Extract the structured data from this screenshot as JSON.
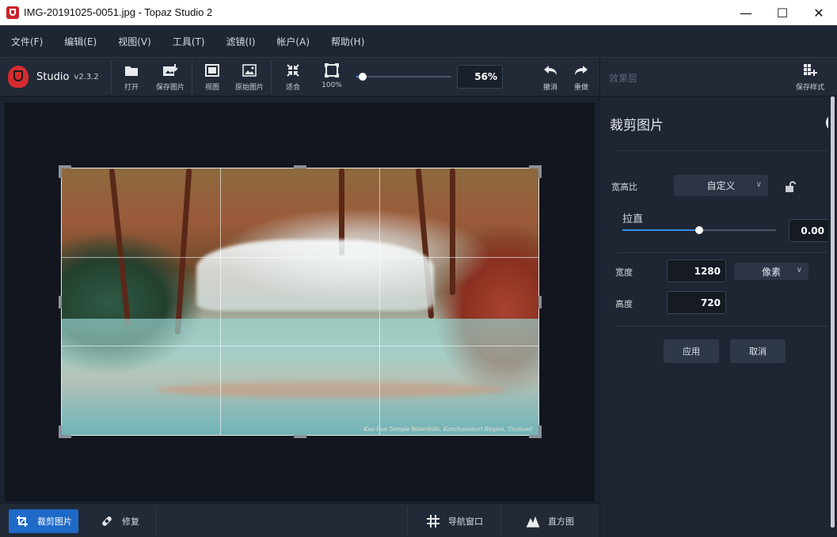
{
  "window": {
    "title": "IMG-20191025-0051.jpg - Topaz Studio 2",
    "minimize_glyph": "—",
    "maximize_glyph": "☐",
    "close_glyph": "✕"
  },
  "menu": {
    "items": [
      {
        "label": "文件(F)"
      },
      {
        "label": "编辑(E)"
      },
      {
        "label": "视图(V)"
      },
      {
        "label": "工具(T)"
      },
      {
        "label": "滤镜(I)"
      },
      {
        "label": "帐户(A)"
      },
      {
        "label": "帮助(H)"
      }
    ]
  },
  "brand": {
    "name": "Studio",
    "version": "v2.3.2"
  },
  "toolbar": {
    "open": "打开",
    "save_image": "保存图片",
    "view": "视图",
    "original_image": "原始图片",
    "fit": "适合",
    "zoom_100": "100%",
    "zoom_value": "56%",
    "zoom_level": 0.07,
    "undo": "撤消",
    "redo": "重做"
  },
  "effects_header": {
    "label": "效果层",
    "save_style": "保存样式"
  },
  "photo": {
    "caption": "Kao Fun Temple Waterfalls, Kanchanaburi Region, Thailand"
  },
  "bottombar": {
    "crop_image": "裁剪图片",
    "repair": "修复",
    "navigator": "导航窗口",
    "histogram": "直方图"
  },
  "crop_panel": {
    "title": "裁剪图片",
    "aspect_label": "宽高比",
    "aspect_value": "自定义",
    "straighten_label": "拉直",
    "straighten_value": "0.00",
    "straighten_level": 0.5,
    "width_label": "宽度",
    "width_value": "1280",
    "unit_value": "像素",
    "height_label": "高度",
    "height_value": "720",
    "apply": "应用",
    "cancel": "取消"
  },
  "colors": {
    "accent": "#1f6ac8",
    "slider_fill": "#3c8ee8",
    "panel_bg": "#1e2533",
    "brand_red": "#d52b2f"
  }
}
